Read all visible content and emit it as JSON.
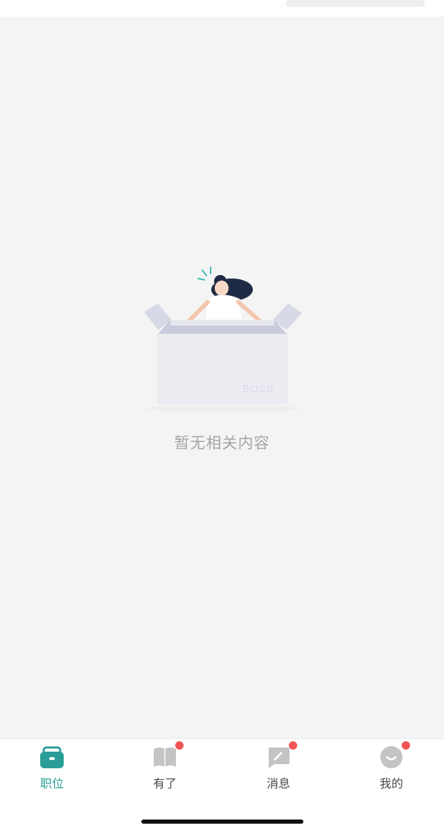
{
  "empty_state": {
    "message": "暂无相关内容",
    "box_watermark": "BOSS"
  },
  "tab_bar": {
    "items": [
      {
        "label": "职位",
        "icon": "briefcase-icon",
        "active": true,
        "badge": false
      },
      {
        "label": "有了",
        "icon": "book-icon",
        "active": false,
        "badge": true
      },
      {
        "label": "消息",
        "icon": "chat-icon",
        "active": false,
        "badge": true
      },
      {
        "label": "我的",
        "icon": "profile-icon",
        "active": false,
        "badge": true
      }
    ]
  },
  "colors": {
    "accent": "#2a9d96",
    "badge": "#f05454",
    "inactive_icon": "#c4c4c4",
    "text_muted": "#a6a6a6"
  }
}
